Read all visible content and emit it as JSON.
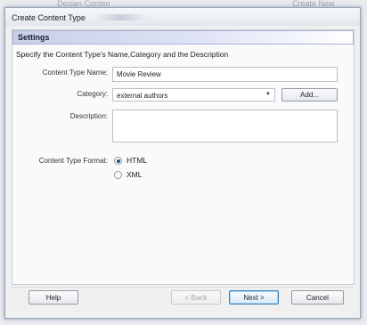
{
  "background": {
    "left_text": "Desian Conten",
    "right_text": "Create New"
  },
  "dialog": {
    "title": "Create Content Type",
    "section_header": "Settings",
    "intro": "Specify the Content Type's Name,Category and the Description"
  },
  "form": {
    "name_label": "Content Type Name:",
    "name_value": "Movie Review",
    "category_label": "Category:",
    "category_value": "external authors",
    "add_button": "Add...",
    "description_label": "Description:",
    "description_value": "",
    "format_label": "Content Type Format:",
    "format_options": [
      {
        "label": "HTML",
        "selected": true
      },
      {
        "label": "XML",
        "selected": false
      }
    ]
  },
  "footer": {
    "help": "Help",
    "back": "< Back",
    "next": "Next >",
    "cancel": "Cancel"
  },
  "colors": {
    "header_accent": "#c9cfe8",
    "primary_button_border": "#3c7fb1"
  }
}
